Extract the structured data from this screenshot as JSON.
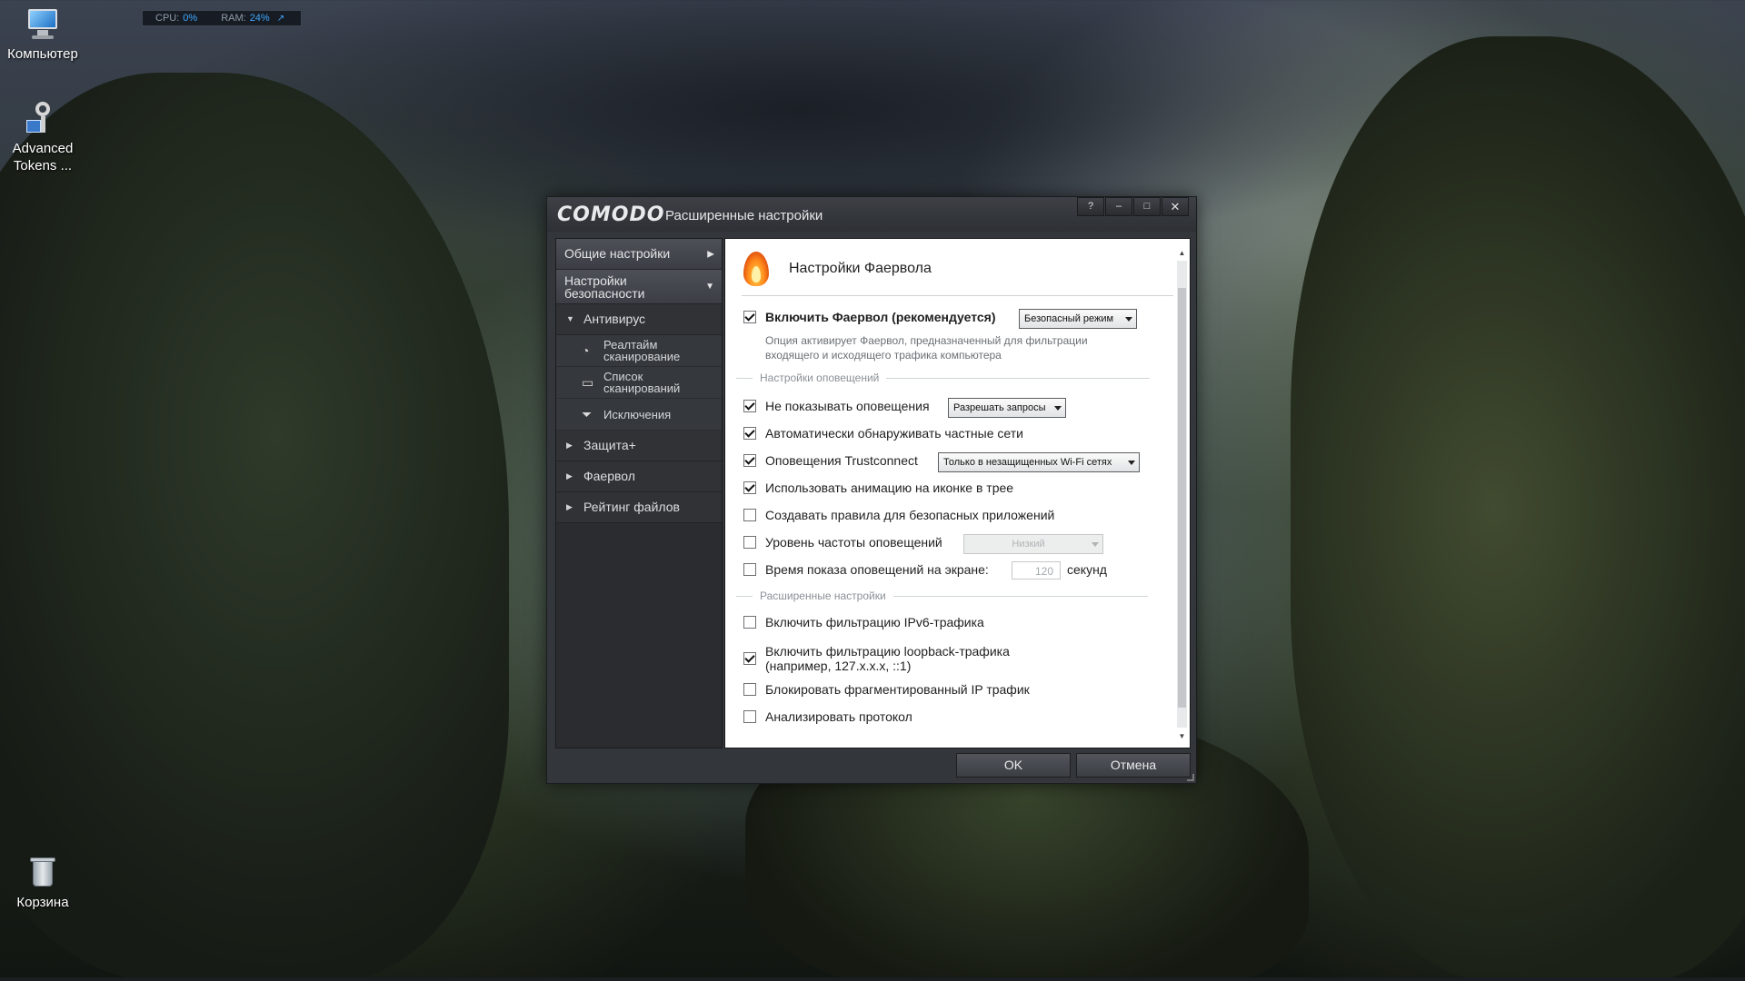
{
  "desktop": {
    "icons": [
      {
        "label": "Компьютер",
        "icon": "computer-icon"
      },
      {
        "label": "Advanced Tokens ...",
        "icon": "key-icon"
      },
      {
        "label": "Корзина",
        "icon": "recycle-bin-icon"
      }
    ],
    "sysmon": {
      "cpu_label": "CPU:",
      "cpu_value": "0%",
      "ram_label": "RAM:",
      "ram_value": "24%",
      "expand": "↗"
    }
  },
  "window": {
    "logo": "COMODO",
    "title": "Расширенные настройки",
    "buttons": {
      "help": "?",
      "minimize": "–",
      "maximize": "□",
      "close": "✕"
    },
    "nav": {
      "general": "Общие настройки",
      "security": "Настройки безопасности",
      "antivirus": "Антивирус",
      "realtime": "Реалтайм сканирование",
      "scanlist": "Список сканирований",
      "exclusions": "Исключения",
      "defense": "Защита+",
      "firewall": "Фаервол",
      "rating": "Рейтинг файлов"
    },
    "content": {
      "title": "Настройки Фаервола",
      "enable_fw": {
        "label": "Включить Фаервол (рекомендуется)",
        "checked": true,
        "mode": "Безопасный режим"
      },
      "enable_desc": "Опция активирует Фаервол, предназначенный для фильтрации входящего и исходящего трафика компьютера",
      "section_alerts": "Настройки оповещений",
      "no_alerts": {
        "label": "Не показывать оповещения",
        "checked": true,
        "option": "Разрешать запросы"
      },
      "auto_detect": {
        "label": "Автоматически обнаруживать частные сети",
        "checked": true
      },
      "trustconnect": {
        "label": "Оповещения Trustconnect",
        "checked": true,
        "option": "Только в незащищенных Wi-Fi сетях"
      },
      "tray_anim": {
        "label": "Использовать анимацию на иконке в трее",
        "checked": true
      },
      "safe_rules": {
        "label": "Создавать правила для безопасных приложений",
        "checked": false
      },
      "alert_freq": {
        "label": "Уровень частоты оповещений",
        "checked": false,
        "option": "Низкий"
      },
      "alert_time": {
        "label": "Время показа оповещений на экране:",
        "checked": false,
        "value": "120",
        "unit": "секунд"
      },
      "section_adv": "Расширенные настройки",
      "ipv6": {
        "label": "Включить фильтрацию IPv6-трафика",
        "checked": false
      },
      "loopback": {
        "label": "Включить фильтрацию loopback-трафика",
        "label2": "(например, 127.x.x.x, ::1)",
        "checked": true
      },
      "frag": {
        "label": "Блокировать фрагментированный IP трафик",
        "checked": false
      },
      "proto": {
        "label": "Анализировать протокол",
        "checked": false
      }
    },
    "ok": "OK",
    "cancel": "Отмена"
  }
}
